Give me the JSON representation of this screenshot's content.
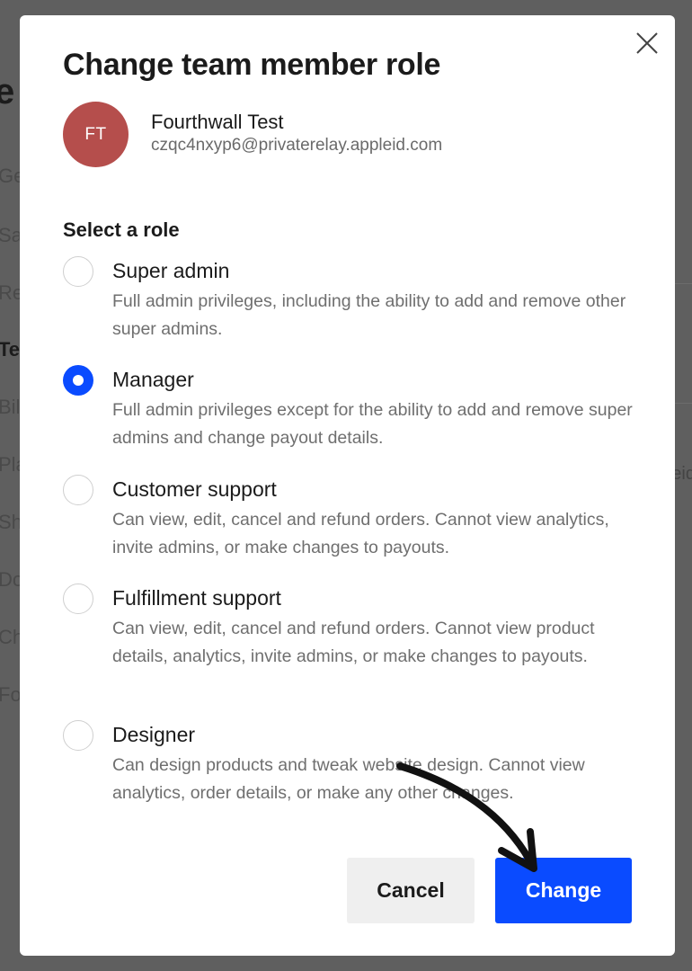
{
  "background": {
    "heading_fragment": "e",
    "nav_fragments": [
      "Ge",
      "Sa",
      "Re",
      "Te",
      "Bil",
      "Pla",
      "Sh",
      "Do",
      "Ch",
      "Fo"
    ],
    "active_index": 3,
    "right_fragment": "eid"
  },
  "modal": {
    "title": "Change team member role",
    "member": {
      "initials": "FT",
      "name": "Fourthwall Test",
      "email": "czqc4nxyp6@privaterelay.appleid.com",
      "avatar_color": "#b54e4c"
    },
    "section_label": "Select a role",
    "roles": [
      {
        "name": "Super admin",
        "description": "Full admin privileges, including the ability to add and remove other super admins.",
        "selected": false
      },
      {
        "name": "Manager",
        "description": "Full admin privileges except for the ability to add and remove super admins and change payout details.",
        "selected": true
      },
      {
        "name": "Customer support",
        "description": "Can view, edit, cancel and refund orders. Cannot view analytics, invite admins, or make changes to payouts.",
        "selected": false
      },
      {
        "name": "Fulfillment support",
        "description": "Can view, edit, cancel and refund orders. Cannot view product details, analytics, invite admins, or make changes to payouts.",
        "selected": false
      },
      {
        "name": "Designer",
        "description": "Can design products and tweak website design. Cannot view analytics, order details, or make any other changes.",
        "selected": false
      }
    ],
    "cancel_label": "Cancel",
    "change_label": "Change",
    "icons": {
      "close": "close-icon",
      "annotation": "arrow-annotation"
    },
    "colors": {
      "accent": "#0a4bff",
      "overlay": "#5f5f5f"
    }
  }
}
